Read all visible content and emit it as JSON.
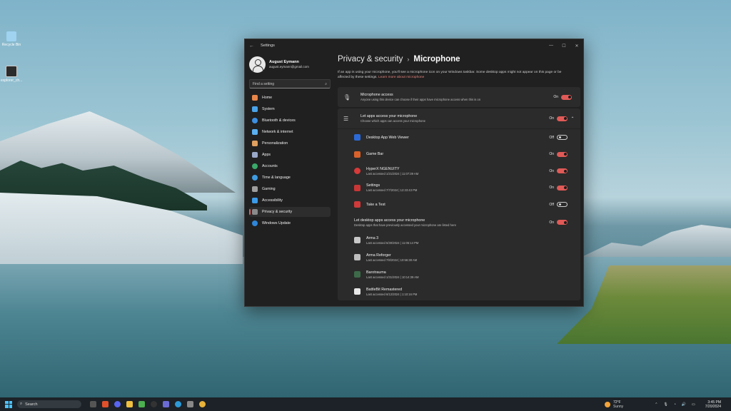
{
  "desktop": {
    "icons": [
      {
        "label": "Recycle Bin",
        "color": "#9fd3f0"
      },
      {
        "label": "explorer_ch...",
        "color": "#2c2c2c"
      }
    ]
  },
  "window": {
    "title": "Settings",
    "controls": {
      "minimize": "—",
      "maximize": "☐",
      "close": "✕"
    }
  },
  "profile": {
    "name": "August Eymann",
    "email": "august.eymann@gmail.com"
  },
  "search": {
    "placeholder": "Find a setting",
    "icon": "search-icon"
  },
  "sidebar": {
    "items": [
      {
        "label": "Home",
        "icon": "home-icon",
        "color": "#e8864a"
      },
      {
        "label": "System",
        "icon": "monitor-icon",
        "color": "#4aa3e8"
      },
      {
        "label": "Bluetooth & devices",
        "icon": "bluetooth-icon",
        "color": "#3d8fe0"
      },
      {
        "label": "Network & internet",
        "icon": "wifi-icon",
        "color": "#5ab0f0"
      },
      {
        "label": "Personalization",
        "icon": "brush-icon",
        "color": "#e0a060"
      },
      {
        "label": "Apps",
        "icon": "apps-icon",
        "color": "#9aa8c8"
      },
      {
        "label": "Accounts",
        "icon": "person-icon",
        "color": "#3aa86a"
      },
      {
        "label": "Time & language",
        "icon": "globe-clock-icon",
        "color": "#3f9be0"
      },
      {
        "label": "Gaming",
        "icon": "gamepad-icon",
        "color": "#9e9e9e"
      },
      {
        "label": "Accessibility",
        "icon": "accessibility-icon",
        "color": "#3c9be8"
      },
      {
        "label": "Privacy & security",
        "icon": "shield-icon",
        "color": "#8a8a8a",
        "active": true
      },
      {
        "label": "Windows Update",
        "icon": "update-icon",
        "color": "#2f86d8"
      }
    ]
  },
  "header": {
    "breadcrumb": "Privacy & security",
    "separator": "›",
    "title": "Microphone"
  },
  "intro": {
    "text": "If an app is using your microphone, you'll see a microphone icon on your Windows taskbar. Some desktop apps might not appear on this page or be affected by these settings.",
    "link": "Learn more about microphone"
  },
  "mic_access": {
    "title": "Microphone access",
    "subtitle": "Anyone using this device can choose if their apps have microphone access when this is on",
    "state": "On",
    "on": true
  },
  "apps_access": {
    "title": "Let apps access your microphone",
    "subtitle": "Choose which apps can access your microphone",
    "state": "On",
    "on": true
  },
  "apps": [
    {
      "name": "Desktop App Web Viewer",
      "sub": "",
      "state": "Off",
      "on": false,
      "color": "#2b6ad6"
    },
    {
      "name": "Game Bar",
      "sub": "",
      "state": "On",
      "on": true,
      "color": "#d9622b"
    },
    {
      "name": "HyperX NGENUITY",
      "sub": "Last accessed 1/21/2024  |  11:07:39 AM",
      "state": "On",
      "on": true,
      "color": "#d83a3a"
    },
    {
      "name": "Settings",
      "sub": "Last accessed 7/7/2024  |  12:23:43 PM",
      "state": "On",
      "on": true,
      "color": "#c93636"
    },
    {
      "name": "Take a Test",
      "sub": "",
      "state": "Off",
      "on": false,
      "color": "#d03a3a"
    }
  ],
  "desktop_access": {
    "title": "Let desktop apps access your microphone",
    "subtitle": "Desktop apps that have previously accessed your microphone are listed here",
    "state": "On",
    "on": true
  },
  "desktop_apps": [
    {
      "name": "Arma 3",
      "sub": "Last accessed 5/30/2024  |  11:05:14 PM",
      "color": "#c8c8c8"
    },
    {
      "name": "Arma Reforger",
      "sub": "Last accessed 7/8/2024  |  10:56:38 AM",
      "color": "#bdbdbd"
    },
    {
      "name": "Barotrauma",
      "sub": "Last accessed 1/31/2024  |  10:14:39 AM",
      "color": "#3d6b4a"
    },
    {
      "name": "BattleBit Remastered",
      "sub": "Last accessed 6/12/2024  |  1:10:16 PM",
      "color": "#e6e6e6"
    }
  ],
  "taskbar": {
    "search_label": "Search",
    "weather_temp": "72°F",
    "weather_desc": "Sunny",
    "time": "3:45 PM",
    "date": "7/20/2024",
    "apps": [
      {
        "icon": "file-explorer-icon",
        "color": "#555"
      },
      {
        "icon": "brave-icon",
        "color": "#e0502a"
      },
      {
        "icon": "discord-icon",
        "color": "#5865f2"
      },
      {
        "icon": "folder-icon",
        "color": "#f0c040"
      },
      {
        "icon": "minecraft-icon",
        "color": "#4caf50"
      },
      {
        "icon": "steam-icon",
        "color": "#333"
      },
      {
        "icon": "gamepad-app-icon",
        "color": "#6b6bd6"
      },
      {
        "icon": "edge-icon",
        "color": "#2d9ad8"
      },
      {
        "icon": "settings-app-icon",
        "color": "#888"
      },
      {
        "icon": "chrome-icon",
        "color": "#e8b33a"
      }
    ]
  }
}
